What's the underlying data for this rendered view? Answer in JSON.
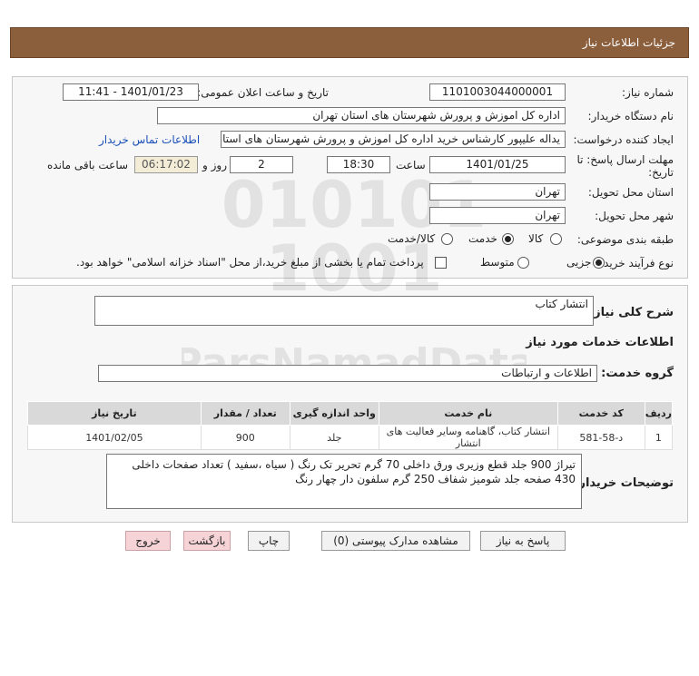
{
  "header": {
    "title": "جزئیات اطلاعات نیاز"
  },
  "form": {
    "need_number_label": "شماره نیاز:",
    "need_number": "1101003044000001",
    "announce_label": "تاریخ و ساعت اعلان عمومی:",
    "announce_value": "1401/01/23 - 11:41",
    "buyer_org_label": "نام دستگاه خریدار:",
    "buyer_org": "اداره کل اموزش و پرورش شهرستان های استان تهران",
    "creator_label": "ایجاد کننده درخواست:",
    "creator": "یداله  علیپور  کارشناس خرید اداره کل اموزش و پرورش شهرستان های استان تهران",
    "contact_link": "اطلاعات تماس خریدار",
    "deadline_label": "مهلت ارسال پاسخ: تا",
    "deadline_label2": "تاریخ:",
    "deadline_date": "1401/01/25",
    "time_label": "ساعت",
    "deadline_time": "18:30",
    "days_value": "2",
    "days_label": "روز و",
    "remaining": "06:17:02",
    "remaining_label": "ساعت باقی مانده",
    "province_label": "استان محل تحویل:",
    "province": "تهران",
    "city_label": "شهر محل تحویل:",
    "city": "تهران",
    "category_label": "طبقه بندی موضوعی:",
    "category_options": [
      "کالا",
      "خدمت",
      "کالا/خدمت"
    ],
    "category_selected": "خدمت",
    "process_label": "نوع فرآیند خرید :",
    "process_options": [
      "جزیی",
      "متوسط"
    ],
    "process_selected": "جزیی",
    "payment_note": "پرداخت تمام یا بخشی از مبلغ خرید،از محل \"اسناد خزانه اسلامی\" خواهد بود."
  },
  "summary": {
    "general_label": "شرح کلی نیاز:",
    "general_value": "انتشار کتاب",
    "services_heading": "اطلاعات خدمات مورد نیاز",
    "service_group_label": "گروه خدمت:",
    "service_group_value": "اطلاعات و ارتباطات"
  },
  "table": {
    "headers": [
      "ردیف",
      "کد خدمت",
      "نام خدمت",
      "واحد اندازه گیری",
      "تعداد / مقدار",
      "تاریخ نیاز"
    ],
    "rows": [
      [
        "1",
        "د-58-581",
        "انتشار کتاب، گاهنامه وسایر فعالیت های انتشار",
        "جلد",
        "900",
        "1401/02/05"
      ]
    ]
  },
  "buyer_notes": {
    "label": "توضیحات خریدار:",
    "line1": "تیراژ 900 جلد  قطع  وزیری  ورق داخلی 70 گرم تحریر  تک رنگ ( سیاه ،سفید )  تعداد صفحات داخلی",
    "line2": "430 صفحه   جلد شومیز شفاف  250 گرم  سلفون دار چهار رنگ"
  },
  "buttons": {
    "reply": "پاسخ به نیاز",
    "attachments": "مشاهده مدارک پیوستی (0)",
    "print": "چاپ",
    "back": "بازگشت",
    "exit": "خروج"
  },
  "watermark": {
    "text": "ParsNamadData"
  }
}
